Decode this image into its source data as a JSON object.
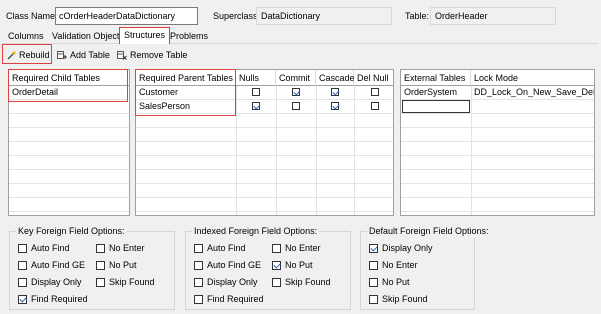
{
  "header": {
    "class_name_label": "Class Name:",
    "class_name_value": "cOrderHeaderDataDictionary",
    "superclass_label": "Superclass:",
    "superclass_value": "DataDictionary",
    "table_label": "Table:",
    "table_value": "OrderHeader"
  },
  "tabs": [
    "Columns",
    "Validation Objects",
    "Structures",
    "Problems"
  ],
  "active_tab": "Structures",
  "toolbar": {
    "rebuild": "Rebuild",
    "add_table": "Add Table",
    "remove_table": "Remove Table"
  },
  "child_grid": {
    "header": "Required Child Tables",
    "rows": [
      "OrderDetail"
    ]
  },
  "parent_grid": {
    "headers": [
      "Required Parent Tables",
      "Nulls",
      "Commit",
      "Cascade",
      "Del Null"
    ],
    "rows": [
      {
        "name": "Customer",
        "nulls": false,
        "commit": true,
        "cascade": true,
        "del_null": false
      },
      {
        "name": "SalesPerson",
        "nulls": true,
        "commit": false,
        "cascade": true,
        "del_null": false
      }
    ]
  },
  "external_grid": {
    "headers": [
      "External Tables",
      "Lock Mode"
    ],
    "rows": [
      {
        "table": "OrderSystem",
        "lock_mode": "DD_Lock_On_New_Save_Delete"
      },
      {
        "table": "",
        "lock_mode": ""
      }
    ]
  },
  "key_fk": {
    "title": "Key Foreign Field Options:",
    "options": [
      {
        "label": "Auto Find",
        "checked": false
      },
      {
        "label": "No Enter",
        "checked": false
      },
      {
        "label": "Auto Find GE",
        "checked": false
      },
      {
        "label": "No Put",
        "checked": false
      },
      {
        "label": "Display Only",
        "checked": false
      },
      {
        "label": "Skip Found",
        "checked": false
      },
      {
        "label": "Find Required",
        "checked": true
      }
    ]
  },
  "indexed_fk": {
    "title": "Indexed Foreign Field Options:",
    "options": [
      {
        "label": "Auto Find",
        "checked": false
      },
      {
        "label": "No Enter",
        "checked": false
      },
      {
        "label": "Auto Find GE",
        "checked": false
      },
      {
        "label": "No Put",
        "checked": true
      },
      {
        "label": "Display Only",
        "checked": false
      },
      {
        "label": "Skip Found",
        "checked": false
      },
      {
        "label": "Find Required",
        "checked": false
      }
    ]
  },
  "default_fk": {
    "title": "Default Foreign Field Options:",
    "options": [
      {
        "label": "Display Only",
        "checked": true
      },
      {
        "label": "No Enter",
        "checked": false
      },
      {
        "label": "No Put",
        "checked": false
      },
      {
        "label": "Skip Found",
        "checked": false
      }
    ]
  },
  "colors": {
    "highlight": "#e04040",
    "check": "#1b5eb8"
  }
}
